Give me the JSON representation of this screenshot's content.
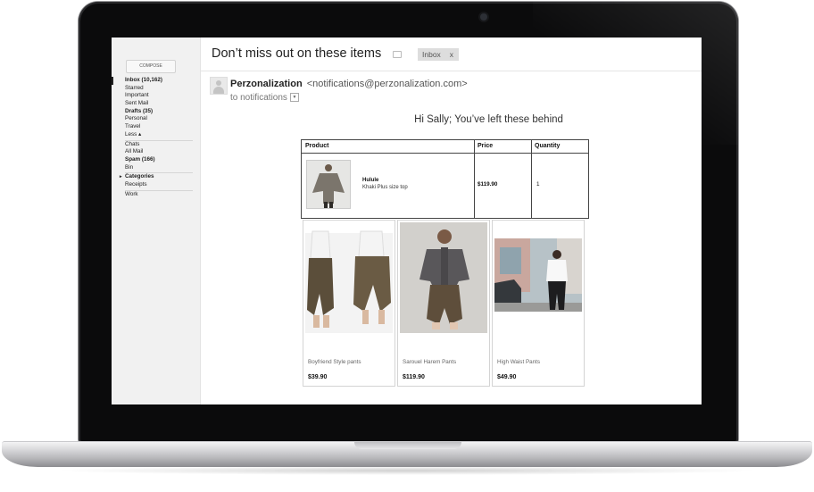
{
  "email": {
    "subject": "Don’t miss out on these items",
    "label_tag": "Inbox",
    "label_close": "x",
    "sender_name": "Perzonalization",
    "sender_address": "<notifications@perzonalization.com>",
    "to_line": "to notifications",
    "greeting": "Hi Sally; You’ve left these behind"
  },
  "sidebar": {
    "compose_label": "COMPOSE",
    "items": [
      {
        "label": "Inbox (10,162)"
      },
      {
        "label": "Starred"
      },
      {
        "label": "Important"
      },
      {
        "label": "Sent Mail"
      },
      {
        "label": "Drafts (35)"
      },
      {
        "label": "Personal"
      },
      {
        "label": "Travel"
      },
      {
        "label": "Less ▴"
      },
      {
        "label": "Chats"
      },
      {
        "label": "All Mail"
      },
      {
        "label": "Spam (166)"
      },
      {
        "label": "Bin"
      },
      {
        "label": "Categories"
      },
      {
        "label": "Receipts"
      },
      {
        "label": "Work"
      }
    ]
  },
  "cart": {
    "headers": {
      "product": "Product",
      "price": "Price",
      "quantity": "Quantity"
    },
    "item": {
      "name": "Hulule",
      "description": "Khaki Plus size top",
      "price": "$119.90",
      "quantity": "1"
    }
  },
  "recommendations": [
    {
      "name": "Boyfriend Style pants",
      "price": "$39.90"
    },
    {
      "name": "Sarouel Harem Pants",
      "price": "$119.90"
    },
    {
      "name": "High Waist Pants",
      "price": "$49.90"
    }
  ],
  "icons": {
    "avatar": "person-icon",
    "label": "label-icon",
    "dropdown": "chevron-down-icon",
    "collapse": "triangle-right-icon"
  }
}
